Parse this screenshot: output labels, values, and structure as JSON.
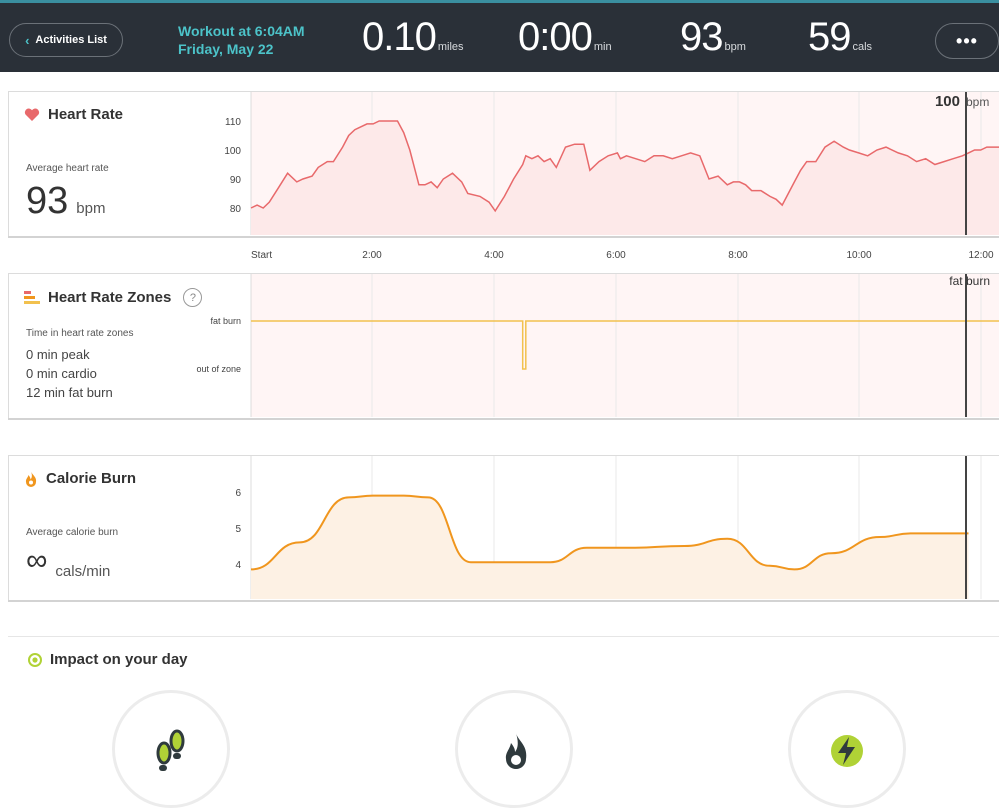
{
  "header": {
    "back_label": "Activities List",
    "workout_title": "Workout at 6:04AM",
    "workout_date": "Friday, May 22",
    "stats": [
      {
        "value": "0.10",
        "unit": "miles"
      },
      {
        "value": "0:00",
        "unit": "min"
      },
      {
        "value": "93",
        "unit": "bpm"
      },
      {
        "value": "59",
        "unit": "cals"
      }
    ],
    "more_label": "•••"
  },
  "heart_rate": {
    "title": "Heart Rate",
    "avg_label": "Average heart rate",
    "avg_value": "93",
    "avg_unit": "bpm",
    "cursor_value": "100",
    "cursor_unit": "bpm"
  },
  "zones": {
    "title": "Heart Rate Zones",
    "help": "?",
    "time_label": "Time in heart rate zones",
    "lines": [
      "0 min peak",
      "0 min cardio",
      "12 min fat burn"
    ],
    "cursor_label": "fat burn"
  },
  "calories": {
    "title": "Calorie Burn",
    "avg_label": "Average calorie burn",
    "avg_value": "∞",
    "avg_unit": "cals/min"
  },
  "impact": {
    "title": "Impact on your day",
    "items": [
      {
        "icon": "footsteps-icon"
      },
      {
        "icon": "flame-icon"
      },
      {
        "icon": "lightning-icon"
      }
    ]
  },
  "colors": {
    "header_bg": "#2a3038",
    "accent_teal": "#4cc3c9",
    "heart_red": "#e8696b",
    "zone_yellow": "#f2c14e",
    "calorie_orange": "#f0961e"
  },
  "chart_data": [
    {
      "type": "line",
      "title": "Heart Rate",
      "x_ticks": [
        "Start",
        "2:00",
        "4:00",
        "6:00",
        "8:00",
        "10:00",
        "12:00"
      ],
      "y_ticks": [
        80,
        90,
        100,
        110
      ],
      "ylim": [
        73,
        118
      ],
      "xlim": [
        0,
        12.25
      ],
      "series": [
        {
          "x": [
            0,
            0.1,
            0.2,
            0.3,
            0.45,
            0.6,
            0.75,
            0.85,
            1.0,
            1.1,
            1.25,
            1.35,
            1.5,
            1.6,
            1.7,
            1.8,
            1.9,
            2.0,
            2.1,
            2.25,
            2.4,
            2.5,
            2.6,
            2.75,
            2.85,
            2.95,
            3.05,
            3.15,
            3.3,
            3.45,
            3.55,
            3.75,
            3.9,
            4.0,
            4.15,
            4.3,
            4.45,
            4.5,
            4.6,
            4.7,
            4.8,
            4.9,
            5.0,
            5.15,
            5.3,
            5.45,
            5.55,
            5.7,
            5.85,
            6.0,
            6.05,
            6.15,
            6.3,
            6.45,
            6.6,
            6.75,
            6.9,
            7.05,
            7.2,
            7.35,
            7.5,
            7.65,
            7.8,
            7.9,
            8.0,
            8.1,
            8.2,
            8.35,
            8.5,
            8.6,
            8.7,
            8.8,
            8.9,
            9.0,
            9.1,
            9.25,
            9.4,
            9.55,
            9.7,
            9.8,
            9.95,
            10.1,
            10.25,
            10.4,
            10.6,
            10.75,
            10.9,
            11.05,
            11.2,
            11.35,
            11.5,
            11.65,
            11.75,
            11.85,
            11.95,
            12.05,
            12.15,
            12.25
          ],
          "y": [
            80,
            81,
            80,
            82,
            87,
            92,
            89,
            90,
            91,
            94,
            96,
            96,
            101,
            105,
            107,
            108,
            109,
            109,
            110,
            110,
            110,
            106,
            100,
            88,
            88,
            89,
            87,
            90,
            92,
            89,
            85,
            84,
            82,
            79,
            84,
            90,
            95,
            98,
            97,
            98,
            96,
            97,
            94,
            101,
            102,
            102,
            93,
            96,
            98,
            99,
            97,
            98,
            97,
            96,
            98,
            98,
            97,
            98,
            99,
            98,
            90,
            91,
            88,
            89,
            89,
            88,
            86,
            86,
            84,
            83,
            81,
            85,
            89,
            93,
            96,
            96,
            101,
            103,
            101,
            100,
            99,
            98,
            100,
            101,
            99,
            98,
            96,
            97,
            95,
            96,
            97,
            98,
            99,
            100,
            100,
            101,
            101,
            101
          ]
        }
      ]
    },
    {
      "type": "line",
      "title": "Heart Rate Zones",
      "y_categories": [
        "fat burn",
        "out of zone"
      ],
      "series": [
        {
          "x": [
            0,
            4.45,
            4.45,
            4.5,
            4.5,
            12.25
          ],
          "y": [
            "fat burn",
            "fat burn",
            "out of zone",
            "out of zone",
            "fat burn",
            "fat burn"
          ]
        }
      ]
    },
    {
      "type": "area",
      "title": "Calorie Burn",
      "y_ticks": [
        4,
        5,
        6
      ],
      "ylim": [
        3.0,
        7.0
      ],
      "xlim": [
        0,
        12.25
      ],
      "series": [
        {
          "x": [
            0,
            0.8,
            1.6,
            2.0,
            2.5,
            2.9,
            3.6,
            4.2,
            4.9,
            5.5,
            6.2,
            7.1,
            7.8,
            8.5,
            8.9,
            9.5,
            10.3,
            10.8,
            11.5,
            11.75
          ],
          "y": [
            3.85,
            4.6,
            5.85,
            5.9,
            5.9,
            5.85,
            4.05,
            4.05,
            4.05,
            4.45,
            4.45,
            4.5,
            4.7,
            3.95,
            3.85,
            4.3,
            4.75,
            4.85,
            4.85,
            4.85
          ]
        }
      ]
    }
  ]
}
